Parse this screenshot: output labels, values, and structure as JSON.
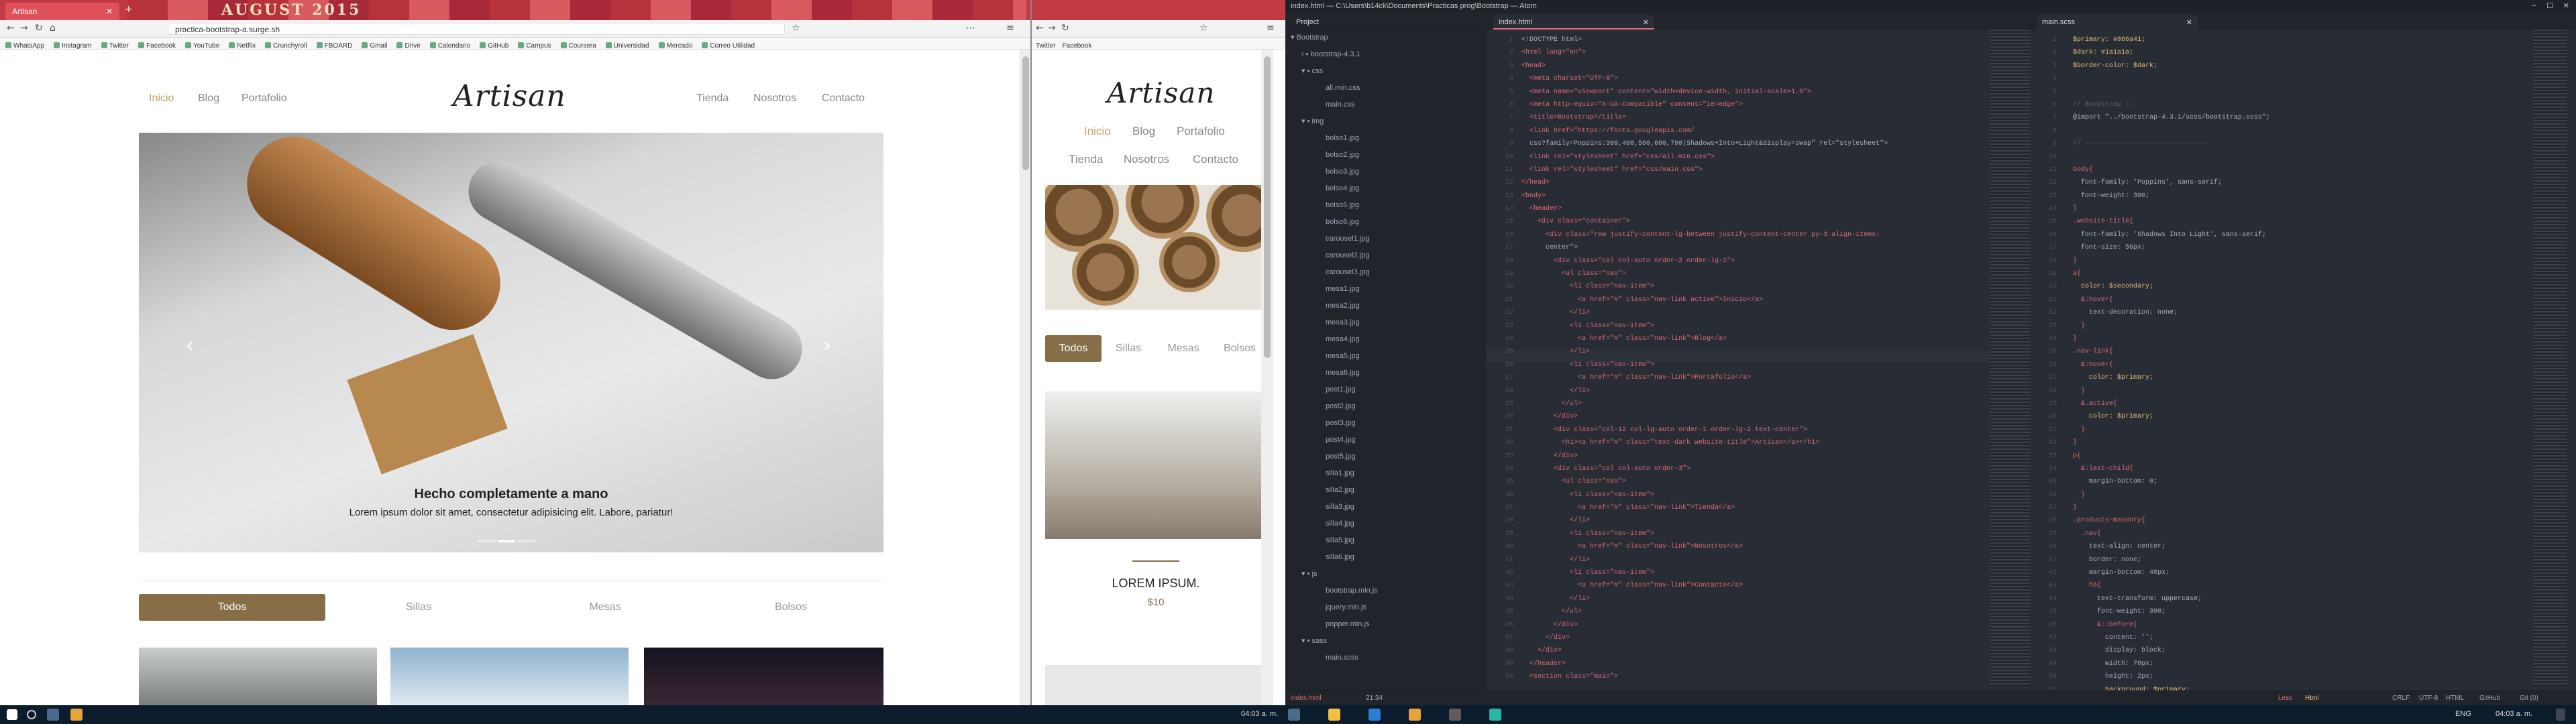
{
  "browser1": {
    "tab_label": "Artisan",
    "banner_text": "AUGUST 2015",
    "url": "practica-bootstrap-a.surge.sh",
    "bookmarks": [
      "WhatsApp",
      "Instagram",
      "Twitter",
      "Facebook",
      "YouTube",
      "Netflix",
      "Crunchyroll",
      "FBOARD",
      "Gmail",
      "Drive",
      "Calendario",
      "GitHub",
      "Campus",
      "Coursera",
      "Universidad",
      "Mercado",
      "Correo Utilidad"
    ]
  },
  "site": {
    "logo": "Artisan",
    "nav_left": [
      "Inicio",
      "Blog",
      "Portafolio"
    ],
    "nav_right": [
      "Tienda",
      "Nosotros",
      "Contacto"
    ],
    "hero_title": "Hecho completamente a mano",
    "hero_text": "Lorem ipsum dolor sit amet, consectetur adipisicing elit. Labore, pariatur!",
    "filters": [
      "Todos",
      "Sillas",
      "Mesas",
      "Bolsos"
    ]
  },
  "browser2": {
    "bookmarks": [
      "Twitter",
      "Facebook"
    ],
    "product_title": "LOREM IPSUM.",
    "product_price": "$10"
  },
  "atom": {
    "window_title": "index.html — C:\\Users\\b14ck\\Documents\\Practicas prog\\Bootstrap — Atom",
    "project_label": "Project",
    "tab_left": "index.html",
    "tab_right": "main.scss",
    "tree": [
      {
        "name": "Bootstrap",
        "t": "root"
      },
      {
        "name": "bootstrap-4.3.1",
        "t": "dir"
      },
      {
        "name": "css",
        "t": "diro"
      },
      {
        "name": "all.min.css",
        "t": "file"
      },
      {
        "name": "main.css",
        "t": "file"
      },
      {
        "name": "img",
        "t": "diro"
      },
      {
        "name": "bolso1.jpg",
        "t": "file"
      },
      {
        "name": "bolso2.jpg",
        "t": "file"
      },
      {
        "name": "bolso3.jpg",
        "t": "file"
      },
      {
        "name": "bolso4.jpg",
        "t": "file"
      },
      {
        "name": "bolso5.jpg",
        "t": "file"
      },
      {
        "name": "bolso6.jpg",
        "t": "file"
      },
      {
        "name": "carousel1.jpg",
        "t": "file"
      },
      {
        "name": "carousel2.jpg",
        "t": "file"
      },
      {
        "name": "carousel3.jpg",
        "t": "file"
      },
      {
        "name": "mesa1.jpg",
        "t": "file"
      },
      {
        "name": "mesa2.jpg",
        "t": "file"
      },
      {
        "name": "mesa3.jpg",
        "t": "file"
      },
      {
        "name": "mesa4.jpg",
        "t": "file"
      },
      {
        "name": "mesa5.jpg",
        "t": "file"
      },
      {
        "name": "mesa6.jpg",
        "t": "file"
      },
      {
        "name": "post1.jpg",
        "t": "file"
      },
      {
        "name": "post2.jpg",
        "t": "file"
      },
      {
        "name": "post3.jpg",
        "t": "file"
      },
      {
        "name": "post4.jpg",
        "t": "file"
      },
      {
        "name": "post5.jpg",
        "t": "file"
      },
      {
        "name": "silla1.jpg",
        "t": "file"
      },
      {
        "name": "silla2.jpg",
        "t": "file"
      },
      {
        "name": "silla3.jpg",
        "t": "file"
      },
      {
        "name": "silla4.jpg",
        "t": "file"
      },
      {
        "name": "silla5.jpg",
        "t": "file"
      },
      {
        "name": "silla6.jpg",
        "t": "file"
      },
      {
        "name": "js",
        "t": "diro"
      },
      {
        "name": "bootstrap.min.js",
        "t": "file"
      },
      {
        "name": "jquery.min.js",
        "t": "file"
      },
      {
        "name": "popper.min.js",
        "t": "file"
      },
      {
        "name": "sass",
        "t": "diro"
      },
      {
        "name": "main.scss",
        "t": "file"
      }
    ],
    "html_lines": [
      "<!DOCTYPE html>",
      "<html lang=\"en\">",
      "<head>",
      "  <meta charset=\"UTF-8\">",
      "  <meta name=\"viewport\" content=\"width=device-width, initial-scale=1.0\">",
      "  <meta http-equiv=\"X-UA-Compatible\" content=\"ie=edge\">",
      "  <title>Bootstrap</title>",
      "  <link href=\"https://fonts.googleapis.com/",
      "  css?family=Poppins:300,400,500,600,700|Shadows+Into+Light&display=swap\" rel=\"stylesheet\">",
      "  <link rel=\"stylesheet\" href=\"css/all.min.css\">",
      "  <link rel=\"stylesheet\" href=\"css/main.css\">",
      "</head>",
      "<body>",
      "  <header>",
      "    <div class=\"container\">",
      "      <div class=\"row justify-content-lg-between justify-content-center py-3 align-items-",
      "      center\">",
      "        <div class=\"col col-auto order-2 order-lg-1\">",
      "          <ul class=\"nav\">",
      "            <li class=\"nav-item\">",
      "              <a href=\"#\" class=\"nav-link active\">Inicio</a>",
      "            </li>",
      "            <li class=\"nav-item\">",
      "              <a href=\"#\" class=\"nav-link\">Blog</a>",
      "            </li>",
      "            <li class=\"nav-item\">",
      "              <a href=\"#\" class=\"nav-link\">Portafolio</a>",
      "            </li>",
      "          </ul>",
      "        </div>",
      "        <div class=\"col-12 col-lg-auto order-1 order-lg-2 text-center\">",
      "          <h1><a href=\"#\" class=\"text-dark website-title\">Artisan</a></h1>",
      "        </div>",
      "        <div class=\"col col-auto order-3\">",
      "          <ul class=\"nav\">",
      "            <li class=\"nav-item\">",
      "              <a href=\"#\" class=\"nav-link\">Tienda</a>",
      "            </li>",
      "            <li class=\"nav-item\">",
      "              <a href=\"#\" class=\"nav-link\">Nosotros</a>",
      "            </li>",
      "            <li class=\"nav-item\">",
      "              <a href=\"#\" class=\"nav-link\">Contacto</a>",
      "            </li>",
      "          </ul>",
      "        </div>",
      "      </div>",
      "    </div>",
      "  </header>",
      "  <section class=\"main\">"
    ],
    "scss_lines": [
      "  $primary: #866a41;",
      "  $dark: #1a1a1a;",
      "  $border-color: $dark;",
      "",
      "",
      "  // Bootstrap ---",
      "  @import \"../bootstrap-4.3.1/scss/bootstrap.scss\";",
      "",
      "  // -------------------------------",
      "",
      "  body{",
      "    font-family: 'Poppins', sans-serif;",
      "    font-weight: 300;",
      "  }",
      "  .website-title{",
      "    font-family: 'Shadows Into Light', sans-serif;",
      "    font-size: 50px;",
      "  }",
      "  a{",
      "    color: $secondary;",
      "    &:hover{",
      "      text-decoration: none;",
      "    }",
      "  }",
      "  .nav-link{",
      "    &:hover{",
      "      color: $primary;",
      "    }",
      "    &.active{",
      "      color: $primary;",
      "    }",
      "  }",
      "  p{",
      "    &:last-child{",
      "      margin-bottom: 0;",
      "    }",
      "  }",
      "  .products-masonry{",
      "    .nav{",
      "      text-align: center;",
      "      border: none;",
      "      margin-bottom: 40px;",
      "      h6{",
      "        text-transform: uppercase;",
      "        font-weight: 300;",
      "        &::before{",
      "          content: '';",
      "          display: block;",
      "          width: 70px;",
      "          height: 2px;",
      "          background: $primary;"
    ],
    "status_left": "index.html",
    "status_pos": "21:34",
    "status_right": [
      "CRLF",
      "UTF-8",
      "HTML",
      "GitHub",
      "Git (0)"
    ],
    "status_file2": "Less",
    "status_file2b": "Html"
  },
  "taskbar": {
    "time": "04:03 a. m.",
    "lang": "ENG"
  },
  "colors": {
    "accent": "#866f47",
    "active_link": "#c7a06a",
    "atom_bg": "#282c34",
    "tab_red": "#c23a46"
  }
}
